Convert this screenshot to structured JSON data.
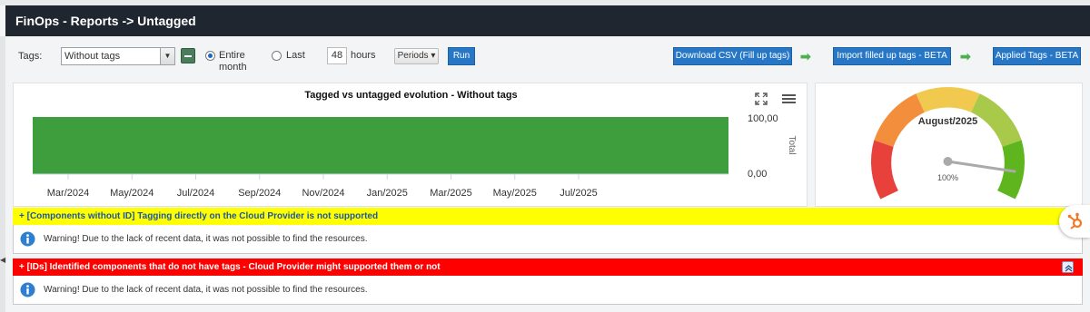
{
  "header": {
    "title": "FinOps - Reports -> Untagged"
  },
  "toolbar": {
    "tags_label": "Tags:",
    "tags_select_value": "Without tags",
    "radio_entire": "Entire",
    "radio_entire_2": "month",
    "radio_last": "Last",
    "hours_value": "48",
    "hours_label": "hours",
    "periods_label": "Periods ▾",
    "run_label": "Run",
    "download_label": "Download CSV (Fill up tags)",
    "import_label": "Import filled up tags - BETA",
    "applied_label": "Applied Tags - BETA",
    "arrow_glyph": "➡"
  },
  "chart": {
    "title": "Tagged vs untagged evolution - Without tags",
    "y_axis_label": "Total",
    "y_ticks": [
      "100,00",
      "0,00"
    ],
    "bar_color": "#3e9e3e"
  },
  "chart_data": {
    "type": "area",
    "title": "Tagged vs untagged evolution - Without tags",
    "ylabel": "Total",
    "ylim": [
      0,
      100
    ],
    "x_tick_labels": [
      "Mar/2024",
      "May/2024",
      "Jul/2024",
      "Sep/2024",
      "Nov/2024",
      "Jan/2025",
      "Mar/2025",
      "May/2025",
      "Jul/2025"
    ],
    "x": [
      "Mar/2024",
      "Aug/2025"
    ],
    "series": [
      {
        "values": [
          100,
          100
        ]
      }
    ],
    "grid": false
  },
  "gauge": {
    "title": "August/2025",
    "value_label": "100%",
    "value": 100
  },
  "sections": [
    {
      "title": "+ [Components without ID] Tagging directly on the Cloud Provider is not supported",
      "message": "Warning! Due to the lack of recent data, it was not possible to find the resources.",
      "color": "#ffff00"
    },
    {
      "title": "+ [IDs] Identified components that do not have tags - Cloud Provider might supported them or not",
      "message": "Warning! Due to the lack of recent data, it was not possible to find the resources.",
      "color": "#ff0000"
    }
  ],
  "icons": {
    "info": "info-icon",
    "hubspot": "hubspot-icon",
    "expand": "fullscreen-icon",
    "menu": "hamburger-menu-icon"
  }
}
